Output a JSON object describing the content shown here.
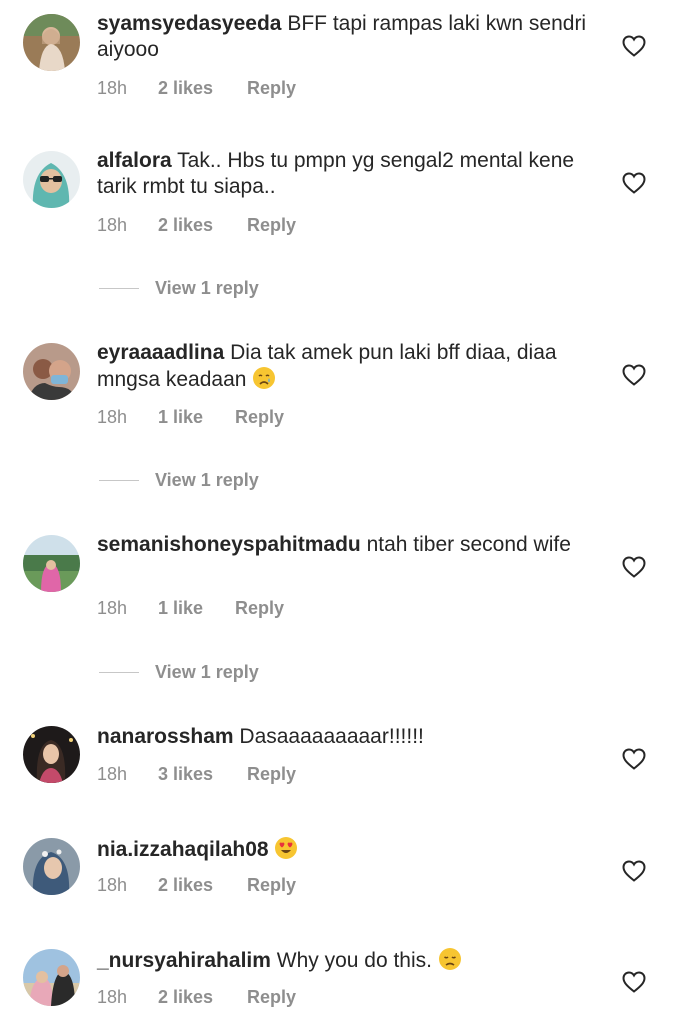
{
  "comments": [
    {
      "username": "syamsyedasyeeda",
      "text": "BFF tapi rampas laki kwn sendri aiyooo",
      "time": "18h",
      "likes": "2 likes",
      "reply": "Reply"
    },
    {
      "username": "alfalora",
      "text": "Tak.. Hbs tu pmpn yg sengal2 mental kene tarik rmbt tu siapa..",
      "time": "18h",
      "likes": "2 likes",
      "reply": "Reply",
      "view_replies": "View 1 reply"
    },
    {
      "username": "eyraaaadlina",
      "text": "Dia tak amek pun laki bff diaa, diaa mngsa keadaan",
      "emoji": "crying-face",
      "time": "18h",
      "likes": "1 like",
      "reply": "Reply",
      "view_replies": "View 1 reply"
    },
    {
      "username": "semanishoneyspahitmadu",
      "text": "ntah tiber second wife",
      "time": "18h",
      "likes": "1 like",
      "reply": "Reply",
      "view_replies": "View 1 reply"
    },
    {
      "username": "nanarossham",
      "text": "Dasaaaaaaaaar!!!!!!",
      "time": "18h",
      "likes": "3 likes",
      "reply": "Reply"
    },
    {
      "username": "nia.izzahaqilah08",
      "text": "",
      "emoji": "heart-eyes-face",
      "time": "18h",
      "likes": "2 likes",
      "reply": "Reply"
    },
    {
      "username": "_nursyahirahalim",
      "text": "Why you do this.",
      "emoji": "disappointed-face",
      "time": "18h",
      "likes": "2 likes",
      "reply": "Reply"
    }
  ],
  "icons": {
    "like": "heart-outline-icon"
  },
  "colors": {
    "text": "#262626",
    "secondary": "#8e8e8e",
    "divider": "#c7c7c7"
  }
}
